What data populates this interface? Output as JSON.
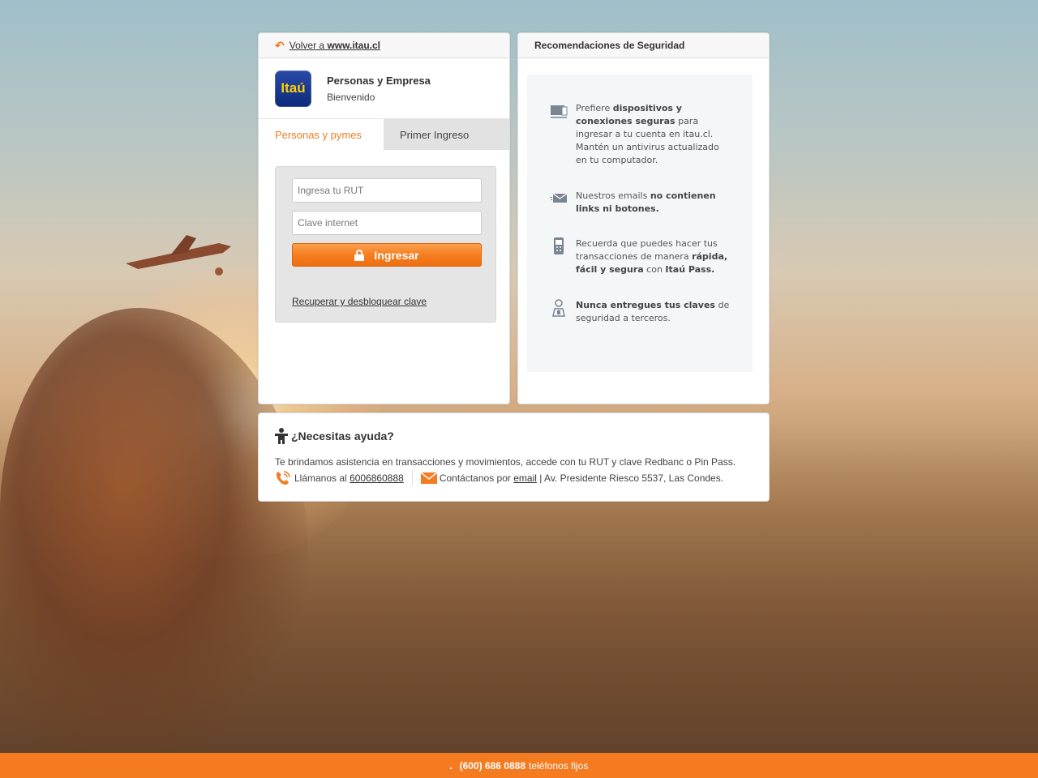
{
  "login": {
    "back_prefix": "Volver a",
    "back_site": "www.itau.cl",
    "logo_text": "Itaú",
    "title": "Personas y Empresa",
    "subtitle": "Bienvenido",
    "tabs": [
      {
        "label": "Personas y pymes",
        "active": true
      },
      {
        "label": "Primer Ingreso",
        "active": false
      }
    ],
    "rut_placeholder": "Ingresa tu RUT",
    "password_placeholder": "Clave internet",
    "submit_label": "Ingresar",
    "recover_label": "Recuperar y desbloquear clave"
  },
  "security": {
    "title": "Recomendaciones de Seguridad",
    "items": [
      {
        "icon": "devices-icon",
        "parts": [
          [
            "Prefiere ",
            false
          ],
          [
            "dispositivos y conexiones seguras",
            true
          ],
          [
            " para ingresar a tu cuenta en itau.cl. Mantén un antivirus actualizado en tu computador.",
            false
          ]
        ]
      },
      {
        "icon": "email-icon",
        "parts": [
          [
            "Nuestros emails ",
            false
          ],
          [
            "no contienen links ni botones.",
            true
          ]
        ]
      },
      {
        "icon": "phone-icon",
        "parts": [
          [
            "Recuerda que puedes hacer tus transacciones de manera ",
            false
          ],
          [
            "rápida, fácil y segura",
            true
          ],
          [
            " con ",
            false
          ],
          [
            "Itaú Pass.",
            true
          ]
        ]
      },
      {
        "icon": "person-key-icon",
        "parts": [
          [
            "Nunca entregues tus claves",
            true
          ],
          [
            " de seguridad a terceros.",
            false
          ]
        ]
      }
    ]
  },
  "help": {
    "title": "¿Necesitas ayuda?",
    "description": "Te brindamos asistencia en transacciones y movimientos, accede con tu RUT y clave Redbanc o Pin Pass.",
    "call_prefix": "Llámanos al",
    "phone": "6006860888",
    "contact_prefix": "Contáctanos por",
    "email_label": "email",
    "address": "|  Av. Presidente Riesco 5537, Las Condes."
  },
  "footer": {
    "phone": "(600) 686 0888",
    "label": "teléfonos fijos"
  },
  "colors": {
    "accent": "#f47b20",
    "brand_blue": "#0b2a7a",
    "brand_yellow": "#ffd200"
  }
}
